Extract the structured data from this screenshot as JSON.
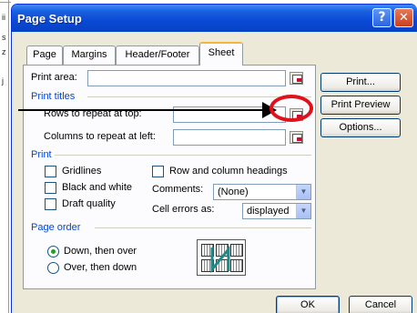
{
  "background": {
    "fragments": [
      "ii",
      "s",
      "z",
      "j"
    ]
  },
  "window": {
    "title": "Page Setup",
    "help_glyph": "?",
    "close_glyph": "✕"
  },
  "tabs": [
    {
      "label": "Page",
      "active": false
    },
    {
      "label": "Margins",
      "active": false
    },
    {
      "label": "Header/Footer",
      "active": false
    },
    {
      "label": "Sheet",
      "active": true
    }
  ],
  "sheet": {
    "print_area_label": "Print area:",
    "print_titles_group": "Print titles",
    "rows_repeat_label": "Rows to repeat at top:",
    "cols_repeat_label": "Columns to repeat at left:",
    "print_group": "Print",
    "gridlines_label": "Gridlines",
    "black_white_label": "Black and white",
    "draft_label": "Draft quality",
    "row_col_headings_label": "Row and column headings",
    "comments_label": "Comments:",
    "comments_value": "(None)",
    "cell_errors_label": "Cell errors as:",
    "cell_errors_value": "displayed",
    "page_order_group": "Page order",
    "down_then_over": "Down, then over",
    "over_then_down": "Over, then down"
  },
  "buttons": {
    "print": "Print...",
    "print_preview": "Print Preview",
    "options": "Options...",
    "ok": "OK",
    "cancel": "Cancel"
  },
  "colors": {
    "titlebar": "#0a49d5",
    "group_heading": "#0046d5",
    "highlight_ring": "#e2101a"
  },
  "icons": {
    "collapse_dialog": "range-select-icon",
    "page_order_preview": "page-order-diagram-icon"
  }
}
